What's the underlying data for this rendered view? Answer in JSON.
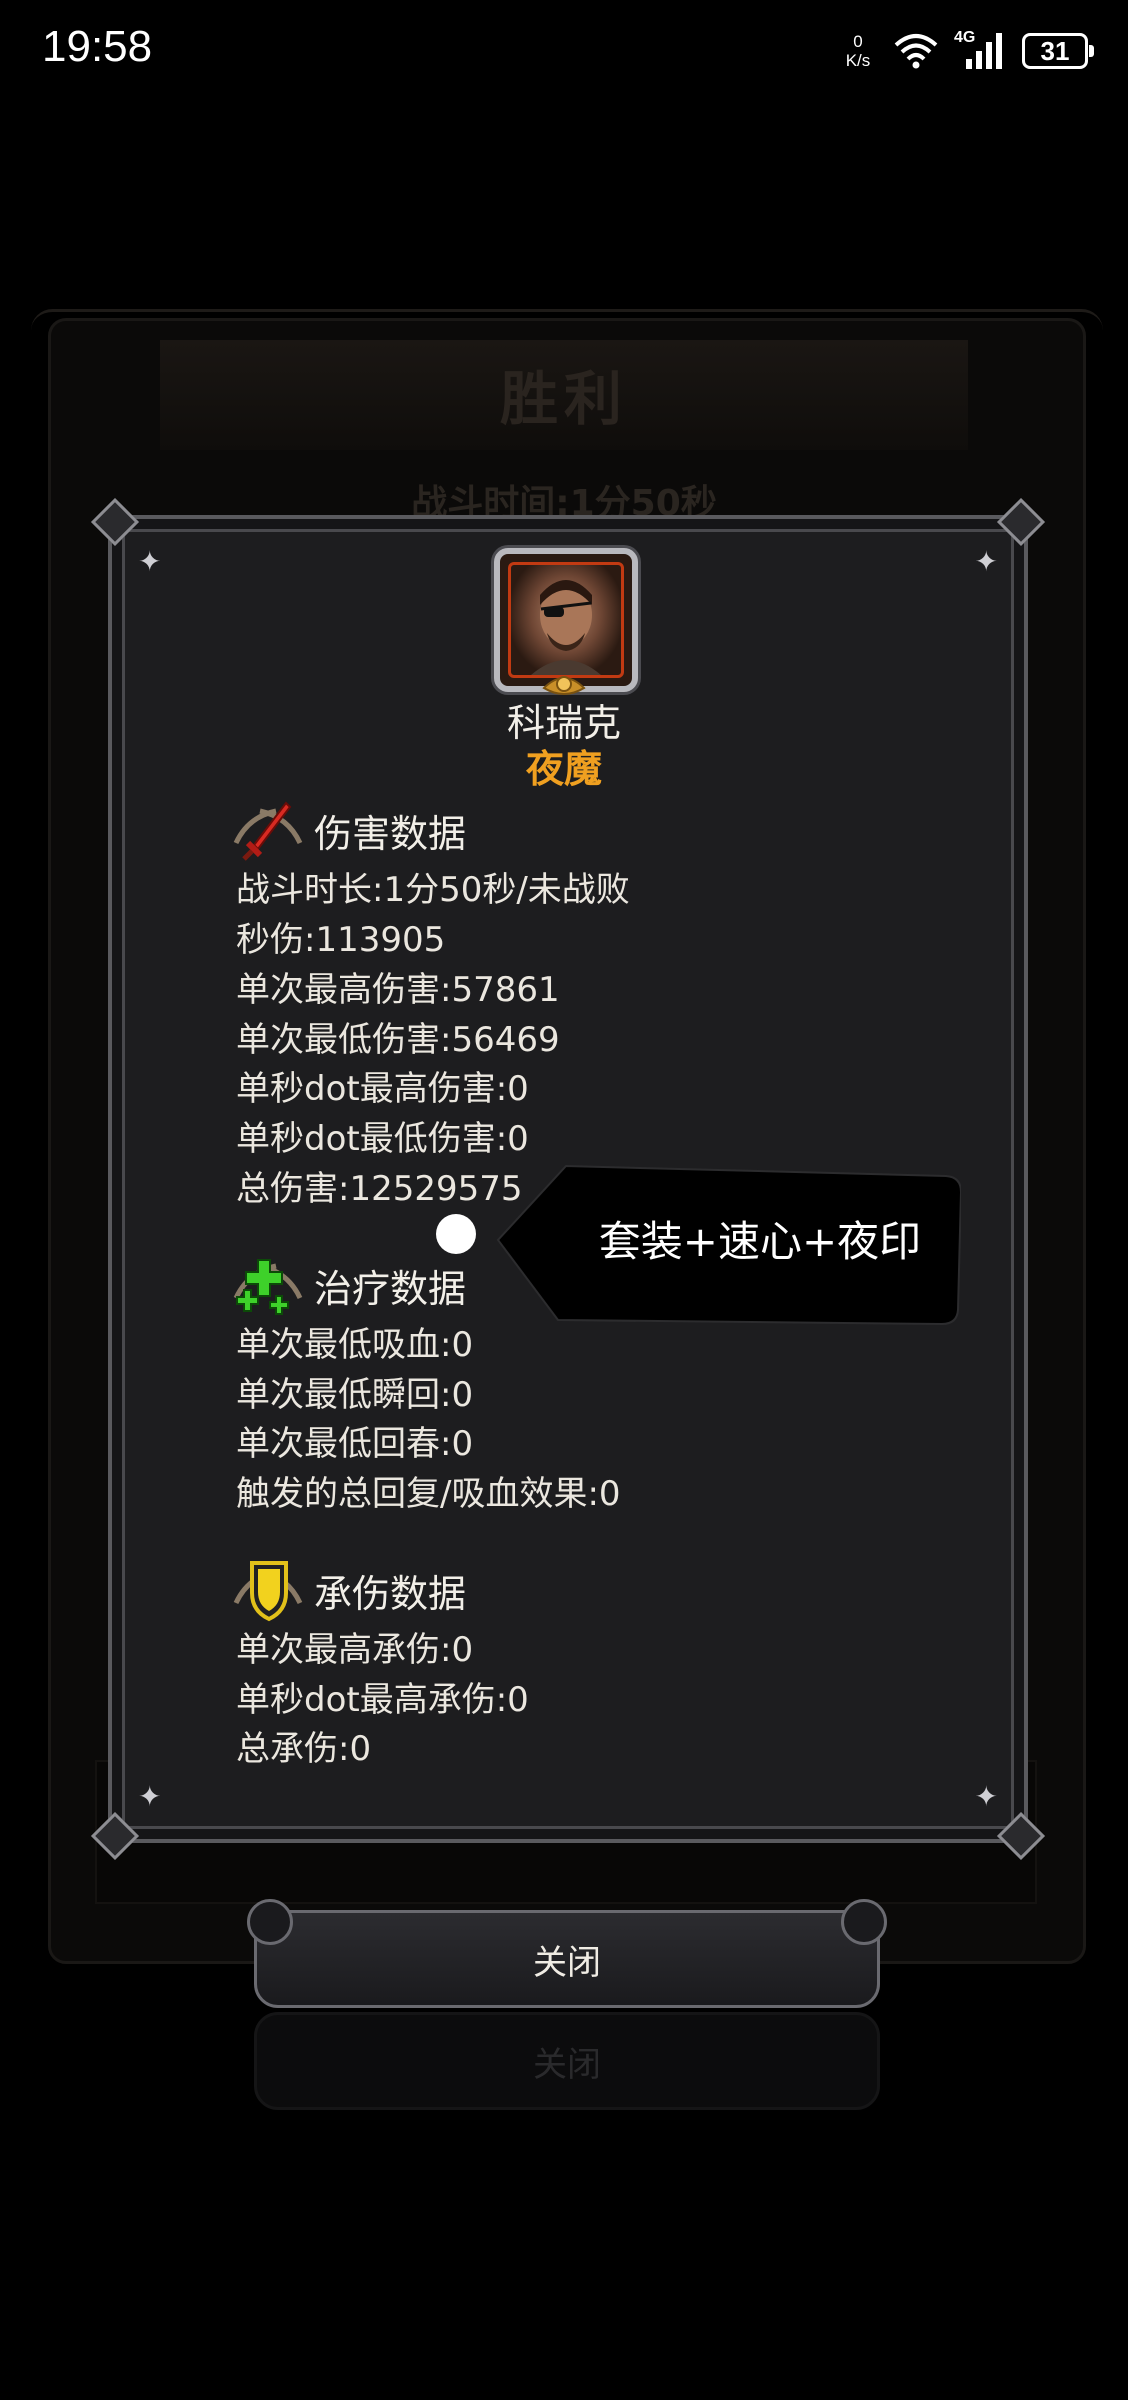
{
  "status_bar": {
    "time": "19:58",
    "net_speed_value": "0",
    "net_speed_unit": "K/s",
    "network_type": "4G",
    "battery_level": "31"
  },
  "background_panel": {
    "title": "胜利",
    "battle_time": "战斗时间:1分50秒"
  },
  "hero": {
    "name": "科瑞克",
    "class": "夜魔",
    "class_color": "#f0a020"
  },
  "damage_section": {
    "title": "伤害数据",
    "icon": "red-sword-icon",
    "stats": [
      "战斗时长:1分50秒/未战败",
      "秒伤:113905",
      "单次最高伤害:57861",
      "单次最低伤害:56469",
      "单秒dot最高伤害:0",
      "单秒dot最低伤害:0",
      "总伤害:12529575"
    ]
  },
  "healing_section": {
    "title": "治疗数据",
    "icon": "green-cross-icon",
    "stats": [
      "单次最低吸血:0",
      "单次最低瞬回:0",
      "单次最低回春:0",
      "触发的总回复/吸血效果:0"
    ]
  },
  "tank_section": {
    "title": "承伤数据",
    "icon": "yellow-shield-icon",
    "stats": [
      "单次最高承伤:0",
      "单秒dot最高承伤:0",
      "总承伤:0"
    ]
  },
  "callout": {
    "text": "套装+速心+夜印"
  },
  "close_button": {
    "label": "关闭",
    "ghost_label": "关闭"
  }
}
